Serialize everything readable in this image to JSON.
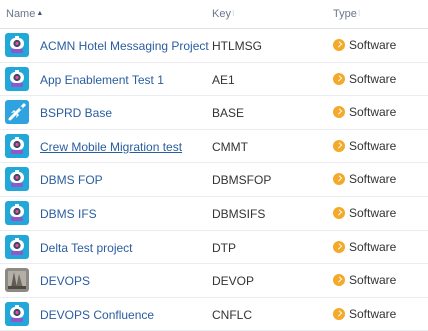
{
  "columns": {
    "name": "Name",
    "key": "Key",
    "type": "Type"
  },
  "projects": [
    {
      "name": "ACMN Hotel Messaging Project",
      "key": "HTLMSG",
      "type": "Software",
      "avatar": "robot-avatar"
    },
    {
      "name": "App Enablement Test 1",
      "key": "AE1",
      "type": "Software",
      "avatar": "robot-avatar"
    },
    {
      "name": "BSPRD Base",
      "key": "BASE",
      "type": "Software",
      "avatar": "rocket-avatar"
    },
    {
      "name": "Crew Mobile Migration test",
      "key": "CMMT",
      "type": "Software",
      "avatar": "robot-avatar"
    },
    {
      "name": "DBMS FOP",
      "key": "DBMSFOP",
      "type": "Software",
      "avatar": "robot-avatar"
    },
    {
      "name": "DBMS IFS",
      "key": "DBMSIFS",
      "type": "Software",
      "avatar": "robot-avatar"
    },
    {
      "name": "Delta Test project",
      "key": "DTP",
      "type": "Software",
      "avatar": "robot-avatar"
    },
    {
      "name": "DEVOPS",
      "key": "DEVOP",
      "type": "Software",
      "avatar": "photo-avatar"
    },
    {
      "name": "DEVOPS Confluence",
      "key": "CNFLC",
      "type": "Software",
      "avatar": "robot-avatar"
    }
  ],
  "colors": {
    "link": "#2a5d9f",
    "avatar_bg": "#21a8d8",
    "type_icon": "#f4a928"
  }
}
